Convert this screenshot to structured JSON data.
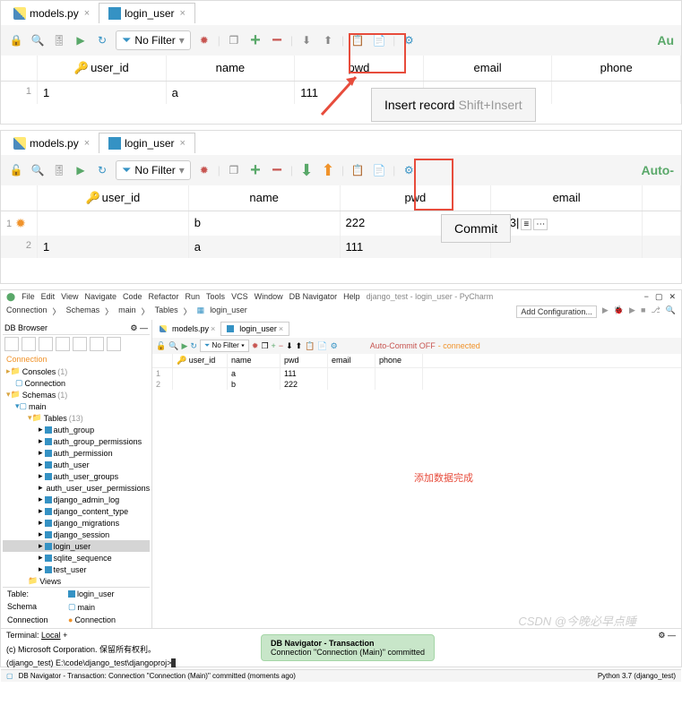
{
  "section1": {
    "tabs": {
      "py": "models.py",
      "db": "login_user"
    },
    "filter": "No Filter",
    "auto": "Au",
    "columns": [
      "user_id",
      "name",
      "pwd",
      "email",
      "phone"
    ],
    "rows": [
      {
        "idx": "1",
        "user_id": "1",
        "name": "a",
        "pwd": "111",
        "email": "",
        "phone": ""
      }
    ],
    "tooltip": {
      "label": "Insert record",
      "shortcut": "Shift+Insert"
    }
  },
  "section2": {
    "tabs": {
      "py": "models.py",
      "db": "login_user"
    },
    "filter": "No Filter",
    "auto": "Auto-",
    "columns": [
      "user_id",
      "name",
      "pwd",
      "email"
    ],
    "rows": [
      {
        "idx": "1",
        "user_id": "",
        "name": "b",
        "pwd": "222",
        "email": "123"
      },
      {
        "idx": "2",
        "user_id": "1",
        "name": "a",
        "pwd": "111",
        "email": ""
      }
    ],
    "commit": "Commit"
  },
  "ide": {
    "menu": [
      "File",
      "Edit",
      "View",
      "Navigate",
      "Code",
      "Refactor",
      "Run",
      "Tools",
      "VCS",
      "Window",
      "DB Navigator",
      "Help"
    ],
    "title": "django_test - login_user - PyCharm",
    "breadcrumb": [
      "Connection",
      "Schemas",
      "main",
      "Tables",
      "login_user"
    ],
    "add_config": "Add Configuration...",
    "db_browser": "DB Browser",
    "tree": {
      "consoles": "Consoles",
      "consoles_count": "(1)",
      "connection": "Connection",
      "schemas": "Schemas",
      "schemas_count": "(1)",
      "main": "main",
      "tables": "Tables",
      "tables_count": "(13)",
      "table_list": [
        "auth_group",
        "auth_group_permissions",
        "auth_permission",
        "auth_user",
        "auth_user_groups",
        "auth_user_user_permissions",
        "django_admin_log",
        "django_content_type",
        "django_migrations",
        "django_session",
        "login_user",
        "sqlite_sequence",
        "test_user"
      ],
      "views": "Views"
    },
    "table_label": "Table:",
    "table_name": "login_user",
    "schema_label": "Schema",
    "schema_val": "main",
    "conn_label": "Connection",
    "conn_val": "Connection",
    "tabs": {
      "py": "models.py",
      "db": "login_user"
    },
    "filter": "No Filter",
    "auto_commit": "Auto-Commit OFF",
    "connected": "- connected",
    "columns": [
      "user_id",
      "name",
      "pwd",
      "email",
      "phone"
    ],
    "rows": [
      {
        "idx": "1",
        "user_id": "",
        "name": "a",
        "pwd": "111",
        "email": "",
        "phone": ""
      },
      {
        "idx": "2",
        "user_id": "",
        "name": "b",
        "pwd": "222",
        "email": "",
        "phone": ""
      }
    ],
    "annotation": "添加数据完成",
    "terminal": {
      "tab": "Terminal:",
      "local": "Local",
      "line1": "(c) Microsoft Corporation. 保留所有权利。",
      "line2": "(django_test) E:\\code\\django_test\\djangoproj>",
      "popup": {
        "title": "DB Navigator - Transaction",
        "msg": "Connection \"Connection (Main)\" committed"
      }
    },
    "status": {
      "item": "DB Navigator - Transaction: Connection \"Connection (Main)\" committed (moments ago)",
      "python": "Python 3.7 (django_test)"
    },
    "watermark": "CSDN @今晚必早点睡"
  }
}
